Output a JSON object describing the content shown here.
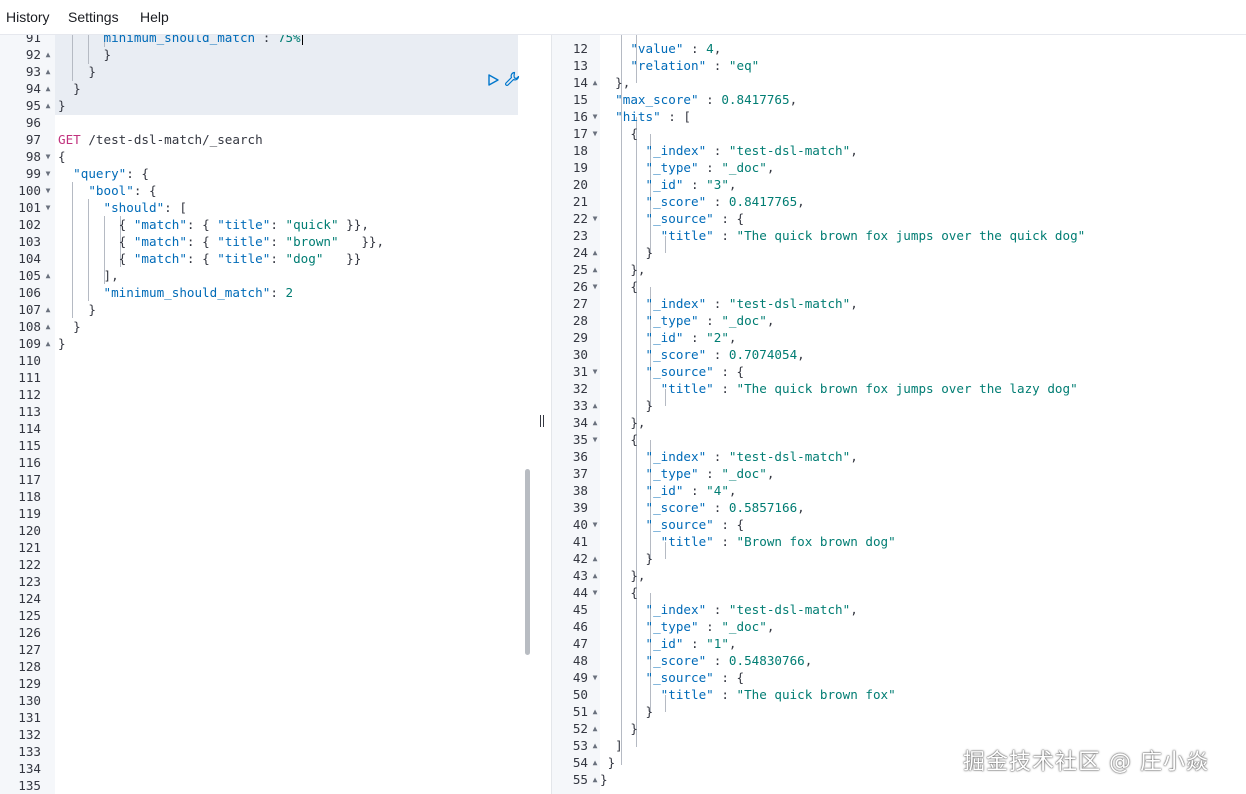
{
  "menu": {
    "history": "History",
    "settings": "Settings",
    "help": "Help"
  },
  "icons": {
    "run": "play-icon",
    "settings": "wrench-icon"
  },
  "colors": {
    "key": "#006bb8",
    "string": "#017d73",
    "method": "#c1327e"
  },
  "left_editor": {
    "lines": [
      {
        "n": "91",
        "fold": "",
        "code": [
          [
            "key",
            "      minimum_should_match"
          ],
          [
            "punc",
            " : "
          ],
          [
            "num",
            "75%"
          ]
        ]
      },
      {
        "n": "92",
        "fold": "up",
        "code": [
          [
            "punc",
            "      }"
          ]
        ]
      },
      {
        "n": "93",
        "fold": "up",
        "code": [
          [
            "punc",
            "    }"
          ]
        ]
      },
      {
        "n": "94",
        "fold": "up",
        "code": [
          [
            "punc",
            "  }"
          ]
        ]
      },
      {
        "n": "95",
        "fold": "up",
        "code": [
          [
            "punc",
            "}"
          ]
        ]
      },
      {
        "n": "96",
        "fold": "",
        "code": []
      },
      {
        "n": "97",
        "fold": "",
        "code": [
          [
            "method",
            "GET"
          ],
          [
            "url",
            " /test-dsl-match/_search"
          ]
        ]
      },
      {
        "n": "98",
        "fold": "down",
        "code": [
          [
            "punc",
            "{"
          ]
        ]
      },
      {
        "n": "99",
        "fold": "down",
        "code": [
          [
            "key",
            "  \"query\""
          ],
          [
            "punc",
            ": {"
          ]
        ]
      },
      {
        "n": "100",
        "fold": "down",
        "code": [
          [
            "key",
            "    \"bool\""
          ],
          [
            "punc",
            ": {"
          ]
        ]
      },
      {
        "n": "101",
        "fold": "down",
        "code": [
          [
            "key",
            "      \"should\""
          ],
          [
            "punc",
            ": ["
          ]
        ]
      },
      {
        "n": "102",
        "fold": "",
        "code": [
          [
            "punc",
            "        { "
          ],
          [
            "key",
            "\"match\""
          ],
          [
            "punc",
            ": { "
          ],
          [
            "key",
            "\"title\""
          ],
          [
            "punc",
            ": "
          ],
          [
            "str",
            "\"quick\""
          ],
          [
            "punc",
            " }},"
          ]
        ]
      },
      {
        "n": "103",
        "fold": "",
        "code": [
          [
            "punc",
            "        { "
          ],
          [
            "key",
            "\"match\""
          ],
          [
            "punc",
            ": { "
          ],
          [
            "key",
            "\"title\""
          ],
          [
            "punc",
            ": "
          ],
          [
            "str",
            "\"brown\""
          ],
          [
            "punc",
            "   }},"
          ]
        ]
      },
      {
        "n": "104",
        "fold": "",
        "code": [
          [
            "punc",
            "        { "
          ],
          [
            "key",
            "\"match\""
          ],
          [
            "punc",
            ": { "
          ],
          [
            "key",
            "\"title\""
          ],
          [
            "punc",
            ": "
          ],
          [
            "str",
            "\"dog\""
          ],
          [
            "punc",
            "   }}"
          ]
        ]
      },
      {
        "n": "105",
        "fold": "up",
        "code": [
          [
            "punc",
            "      ],"
          ]
        ]
      },
      {
        "n": "106",
        "fold": "",
        "code": [
          [
            "key",
            "      \"minimum_should_match\""
          ],
          [
            "punc",
            ": "
          ],
          [
            "num",
            "2"
          ]
        ]
      },
      {
        "n": "107",
        "fold": "up",
        "code": [
          [
            "punc",
            "    }"
          ]
        ]
      },
      {
        "n": "108",
        "fold": "up",
        "code": [
          [
            "punc",
            "  }"
          ]
        ]
      },
      {
        "n": "109",
        "fold": "up",
        "code": [
          [
            "punc",
            "}"
          ]
        ]
      },
      {
        "n": "110",
        "fold": "",
        "code": []
      },
      {
        "n": "111",
        "fold": "",
        "code": []
      },
      {
        "n": "112",
        "fold": "",
        "code": []
      },
      {
        "n": "113",
        "fold": "",
        "code": []
      },
      {
        "n": "114",
        "fold": "",
        "code": []
      },
      {
        "n": "115",
        "fold": "",
        "code": []
      },
      {
        "n": "116",
        "fold": "",
        "code": []
      },
      {
        "n": "117",
        "fold": "",
        "code": []
      },
      {
        "n": "118",
        "fold": "",
        "code": []
      },
      {
        "n": "119",
        "fold": "",
        "code": []
      },
      {
        "n": "120",
        "fold": "",
        "code": []
      },
      {
        "n": "121",
        "fold": "",
        "code": []
      },
      {
        "n": "122",
        "fold": "",
        "code": []
      },
      {
        "n": "123",
        "fold": "",
        "code": []
      },
      {
        "n": "124",
        "fold": "",
        "code": []
      },
      {
        "n": "125",
        "fold": "",
        "code": []
      },
      {
        "n": "126",
        "fold": "",
        "code": []
      },
      {
        "n": "127",
        "fold": "",
        "code": []
      },
      {
        "n": "128",
        "fold": "",
        "code": []
      },
      {
        "n": "129",
        "fold": "",
        "code": []
      },
      {
        "n": "130",
        "fold": "",
        "code": []
      },
      {
        "n": "131",
        "fold": "",
        "code": []
      },
      {
        "n": "132",
        "fold": "",
        "code": []
      },
      {
        "n": "133",
        "fold": "",
        "code": []
      },
      {
        "n": "134",
        "fold": "",
        "code": []
      },
      {
        "n": "135",
        "fold": "",
        "code": []
      }
    ]
  },
  "right_output": {
    "lines": [
      {
        "n": "12",
        "fold": "",
        "code": [
          [
            "key",
            "    \"value\""
          ],
          [
            "punc",
            " : "
          ],
          [
            "num",
            "4"
          ],
          [
            "punc",
            ","
          ]
        ]
      },
      {
        "n": "13",
        "fold": "",
        "code": [
          [
            "key",
            "    \"relation\""
          ],
          [
            "punc",
            " : "
          ],
          [
            "str",
            "\"eq\""
          ]
        ]
      },
      {
        "n": "14",
        "fold": "up",
        "code": [
          [
            "punc",
            "  },"
          ]
        ]
      },
      {
        "n": "15",
        "fold": "",
        "code": [
          [
            "key",
            "  \"max_score\""
          ],
          [
            "punc",
            " : "
          ],
          [
            "num",
            "0.8417765"
          ],
          [
            "punc",
            ","
          ]
        ]
      },
      {
        "n": "16",
        "fold": "down",
        "code": [
          [
            "key",
            "  \"hits\""
          ],
          [
            "punc",
            " : ["
          ]
        ]
      },
      {
        "n": "17",
        "fold": "down",
        "code": [
          [
            "punc",
            "    {"
          ]
        ]
      },
      {
        "n": "18",
        "fold": "",
        "code": [
          [
            "key",
            "      \"_index\""
          ],
          [
            "punc",
            " : "
          ],
          [
            "str",
            "\"test-dsl-match\""
          ],
          [
            "punc",
            ","
          ]
        ]
      },
      {
        "n": "19",
        "fold": "",
        "code": [
          [
            "key",
            "      \"_type\""
          ],
          [
            "punc",
            " : "
          ],
          [
            "str",
            "\"_doc\""
          ],
          [
            "punc",
            ","
          ]
        ]
      },
      {
        "n": "20",
        "fold": "",
        "code": [
          [
            "key",
            "      \"_id\""
          ],
          [
            "punc",
            " : "
          ],
          [
            "str",
            "\"3\""
          ],
          [
            "punc",
            ","
          ]
        ]
      },
      {
        "n": "21",
        "fold": "",
        "code": [
          [
            "key",
            "      \"_score\""
          ],
          [
            "punc",
            " : "
          ],
          [
            "num",
            "0.8417765"
          ],
          [
            "punc",
            ","
          ]
        ]
      },
      {
        "n": "22",
        "fold": "down",
        "code": [
          [
            "key",
            "      \"_source\""
          ],
          [
            "punc",
            " : {"
          ]
        ]
      },
      {
        "n": "23",
        "fold": "",
        "code": [
          [
            "key",
            "        \"title\""
          ],
          [
            "punc",
            " : "
          ],
          [
            "str",
            "\"The quick brown fox jumps over the quick dog\""
          ]
        ]
      },
      {
        "n": "24",
        "fold": "up",
        "code": [
          [
            "punc",
            "      }"
          ]
        ]
      },
      {
        "n": "25",
        "fold": "up",
        "code": [
          [
            "punc",
            "    },"
          ]
        ]
      },
      {
        "n": "26",
        "fold": "down",
        "code": [
          [
            "punc",
            "    {"
          ]
        ]
      },
      {
        "n": "27",
        "fold": "",
        "code": [
          [
            "key",
            "      \"_index\""
          ],
          [
            "punc",
            " : "
          ],
          [
            "str",
            "\"test-dsl-match\""
          ],
          [
            "punc",
            ","
          ]
        ]
      },
      {
        "n": "28",
        "fold": "",
        "code": [
          [
            "key",
            "      \"_type\""
          ],
          [
            "punc",
            " : "
          ],
          [
            "str",
            "\"_doc\""
          ],
          [
            "punc",
            ","
          ]
        ]
      },
      {
        "n": "29",
        "fold": "",
        "code": [
          [
            "key",
            "      \"_id\""
          ],
          [
            "punc",
            " : "
          ],
          [
            "str",
            "\"2\""
          ],
          [
            "punc",
            ","
          ]
        ]
      },
      {
        "n": "30",
        "fold": "",
        "code": [
          [
            "key",
            "      \"_score\""
          ],
          [
            "punc",
            " : "
          ],
          [
            "num",
            "0.7074054"
          ],
          [
            "punc",
            ","
          ]
        ]
      },
      {
        "n": "31",
        "fold": "down",
        "code": [
          [
            "key",
            "      \"_source\""
          ],
          [
            "punc",
            " : {"
          ]
        ]
      },
      {
        "n": "32",
        "fold": "",
        "code": [
          [
            "key",
            "        \"title\""
          ],
          [
            "punc",
            " : "
          ],
          [
            "str",
            "\"The quick brown fox jumps over the lazy dog\""
          ]
        ]
      },
      {
        "n": "33",
        "fold": "up",
        "code": [
          [
            "punc",
            "      }"
          ]
        ]
      },
      {
        "n": "34",
        "fold": "up",
        "code": [
          [
            "punc",
            "    },"
          ]
        ]
      },
      {
        "n": "35",
        "fold": "down",
        "code": [
          [
            "punc",
            "    {"
          ]
        ]
      },
      {
        "n": "36",
        "fold": "",
        "code": [
          [
            "key",
            "      \"_index\""
          ],
          [
            "punc",
            " : "
          ],
          [
            "str",
            "\"test-dsl-match\""
          ],
          [
            "punc",
            ","
          ]
        ]
      },
      {
        "n": "37",
        "fold": "",
        "code": [
          [
            "key",
            "      \"_type\""
          ],
          [
            "punc",
            " : "
          ],
          [
            "str",
            "\"_doc\""
          ],
          [
            "punc",
            ","
          ]
        ]
      },
      {
        "n": "38",
        "fold": "",
        "code": [
          [
            "key",
            "      \"_id\""
          ],
          [
            "punc",
            " : "
          ],
          [
            "str",
            "\"4\""
          ],
          [
            "punc",
            ","
          ]
        ]
      },
      {
        "n": "39",
        "fold": "",
        "code": [
          [
            "key",
            "      \"_score\""
          ],
          [
            "punc",
            " : "
          ],
          [
            "num",
            "0.5857166"
          ],
          [
            "punc",
            ","
          ]
        ]
      },
      {
        "n": "40",
        "fold": "down",
        "code": [
          [
            "key",
            "      \"_source\""
          ],
          [
            "punc",
            " : {"
          ]
        ]
      },
      {
        "n": "41",
        "fold": "",
        "code": [
          [
            "key",
            "        \"title\""
          ],
          [
            "punc",
            " : "
          ],
          [
            "str",
            "\"Brown fox brown dog\""
          ]
        ]
      },
      {
        "n": "42",
        "fold": "up",
        "code": [
          [
            "punc",
            "      }"
          ]
        ]
      },
      {
        "n": "43",
        "fold": "up",
        "code": [
          [
            "punc",
            "    },"
          ]
        ]
      },
      {
        "n": "44",
        "fold": "down",
        "code": [
          [
            "punc",
            "    {"
          ]
        ]
      },
      {
        "n": "45",
        "fold": "",
        "code": [
          [
            "key",
            "      \"_index\""
          ],
          [
            "punc",
            " : "
          ],
          [
            "str",
            "\"test-dsl-match\""
          ],
          [
            "punc",
            ","
          ]
        ]
      },
      {
        "n": "46",
        "fold": "",
        "code": [
          [
            "key",
            "      \"_type\""
          ],
          [
            "punc",
            " : "
          ],
          [
            "str",
            "\"_doc\""
          ],
          [
            "punc",
            ","
          ]
        ]
      },
      {
        "n": "47",
        "fold": "",
        "code": [
          [
            "key",
            "      \"_id\""
          ],
          [
            "punc",
            " : "
          ],
          [
            "str",
            "\"1\""
          ],
          [
            "punc",
            ","
          ]
        ]
      },
      {
        "n": "48",
        "fold": "",
        "code": [
          [
            "key",
            "      \"_score\""
          ],
          [
            "punc",
            " : "
          ],
          [
            "num",
            "0.54830766"
          ],
          [
            "punc",
            ","
          ]
        ]
      },
      {
        "n": "49",
        "fold": "down",
        "code": [
          [
            "key",
            "      \"_source\""
          ],
          [
            "punc",
            " : {"
          ]
        ]
      },
      {
        "n": "50",
        "fold": "",
        "code": [
          [
            "key",
            "        \"title\""
          ],
          [
            "punc",
            " : "
          ],
          [
            "str",
            "\"The quick brown fox\""
          ]
        ]
      },
      {
        "n": "51",
        "fold": "up",
        "code": [
          [
            "punc",
            "      }"
          ]
        ]
      },
      {
        "n": "52",
        "fold": "up",
        "code": [
          [
            "punc",
            "    }"
          ]
        ]
      },
      {
        "n": "53",
        "fold": "up",
        "code": [
          [
            "punc",
            "  ]"
          ]
        ]
      },
      {
        "n": "54",
        "fold": "up",
        "code": [
          [
            "punc",
            " }"
          ]
        ]
      },
      {
        "n": "55",
        "fold": "up",
        "code": [
          [
            "punc",
            "}"
          ]
        ]
      }
    ]
  },
  "watermark": "掘金技术社区 @ 庄小焱"
}
